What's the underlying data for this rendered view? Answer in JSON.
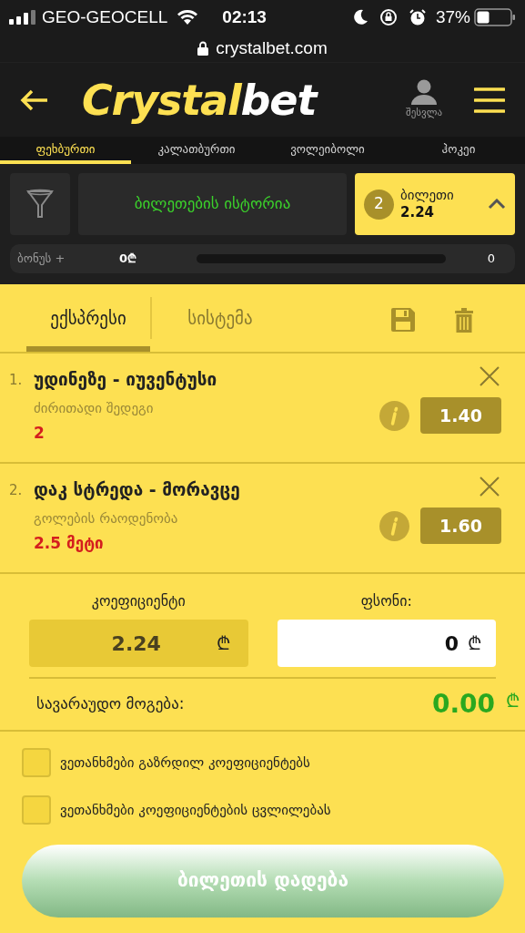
{
  "status_bar": {
    "carrier": "GEO-GEOCELL",
    "time": "02:13",
    "battery": "37%"
  },
  "address_bar": {
    "url": "crystalbet.com"
  },
  "header": {
    "logo_primary": "Crystal",
    "logo_secondary": "bet",
    "login_label": "შესვლა"
  },
  "sport_tabs": [
    {
      "label": "ფეხბურთი",
      "selected": true
    },
    {
      "label": "კალათბურთი",
      "selected": false
    },
    {
      "label": "ვოლეიბოლი",
      "selected": false
    },
    {
      "label": "ჰოკეი",
      "selected": false
    }
  ],
  "history_button": "ბილეთების ისტორია",
  "ticket_button": {
    "count": "2",
    "label": "ბილეთი",
    "odds": "2.24"
  },
  "bonus": {
    "label": "ბონუს +",
    "amount": "0₾",
    "count": "0"
  },
  "slip_tabs": [
    {
      "label": "ექსპრესი",
      "selected": true
    },
    {
      "label": "სისტემა",
      "selected": false
    }
  ],
  "bets": [
    {
      "index": "1.",
      "match": "უდინეზე - იუვენტუსი",
      "market": "ძირითადი შედეგი",
      "pick": "2",
      "odds": "1.40"
    },
    {
      "index": "2.",
      "match": "დაკ სტრედა - მორავცე",
      "market": "გოლების რაოდენობა",
      "pick": "2.5 მეტი",
      "odds": "1.60"
    }
  ],
  "coefficient": {
    "label": "კოეფიციენტი",
    "value": "2.24",
    "currency": "₾"
  },
  "stake": {
    "label": "ფსონი:",
    "value": "0",
    "currency": "₾"
  },
  "potential_win": {
    "label": "სავარაუდო მოგება:",
    "value": "0.00",
    "currency": "₾"
  },
  "agreements": [
    {
      "label": "ვეთანხმები გაზრდილ კოეფიციენტებს",
      "checked": false
    },
    {
      "label": "ვეთანხმები კოეფიციენტების ცვლილებას",
      "checked": false
    }
  ],
  "place_bet_button": "ბილეთის დადება"
}
